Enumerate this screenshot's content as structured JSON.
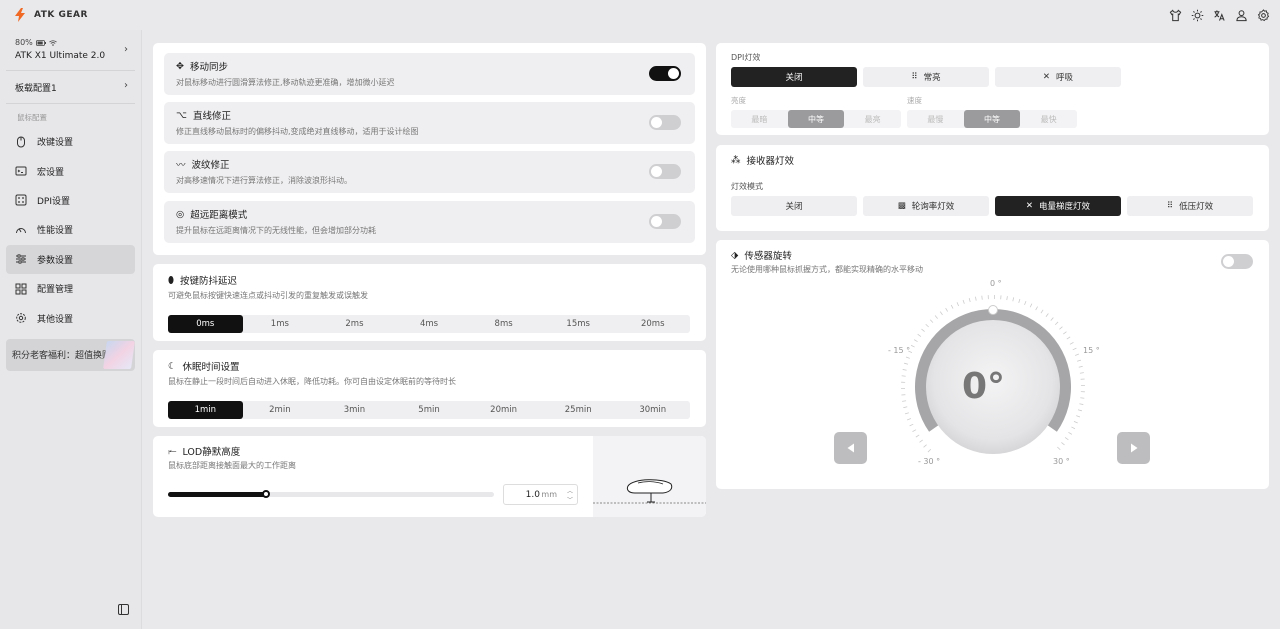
{
  "brand": {
    "name": "ATK GEAR"
  },
  "topbar": {
    "icons": [
      "shirt-icon",
      "sun-icon",
      "translate-icon",
      "user-icon",
      "gear-icon"
    ]
  },
  "device": {
    "battery": "80%",
    "name": "ATK X1 Ultimate 2.0"
  },
  "profile": {
    "label": "板载配置1"
  },
  "sidebar": {
    "section_label": "鼠标配置",
    "items": [
      {
        "label": "改键设置",
        "icon": "mouse-icon"
      },
      {
        "label": "宏设置",
        "icon": "macro-icon"
      },
      {
        "label": "DPI设置",
        "icon": "dpi-icon"
      },
      {
        "label": "性能设置",
        "icon": "gauge-icon"
      },
      {
        "label": "参数设置",
        "icon": "sliders-icon"
      },
      {
        "label": "配置管理",
        "icon": "grid-icon"
      },
      {
        "label": "其他设置",
        "icon": "gear-icon"
      }
    ],
    "active_index": 4,
    "promo": "积分老客福利：超值换购"
  },
  "features": [
    {
      "title": "移动同步",
      "desc": "对鼠标移动进行圆滑算法修正,移动轨迹更准确，增加微小延迟",
      "on": true
    },
    {
      "title": "直线修正",
      "desc": "修正直线移动鼠标时的偏移抖动,变成绝对直线移动，适用于设计绘图",
      "on": false
    },
    {
      "title": "波纹修正",
      "desc": "对高移速情况下进行算法修正，消除波浪形抖动。",
      "on": false
    },
    {
      "title": "超远距离模式",
      "desc": "提升鼠标在远距离情况下的无线性能，但会增加部分功耗",
      "on": false
    }
  ],
  "debounce": {
    "title": "按键防抖延迟",
    "desc": "可避免鼠标按键快速连点或抖动引发的重复触发或误触发",
    "options": [
      "0ms",
      "1ms",
      "2ms",
      "4ms",
      "8ms",
      "15ms",
      "20ms"
    ],
    "selected": 0
  },
  "sleep": {
    "title": "休眠时间设置",
    "desc": "鼠标在静止一段时间后自动进入休眠，降低功耗。你可自由设定休眠前的等待时长",
    "options": [
      "1min",
      "2min",
      "3min",
      "5min",
      "20min",
      "25min",
      "30min"
    ],
    "selected": 0
  },
  "lod": {
    "title": "LOD静默高度",
    "desc": "鼠标底部距离接触面最大的工作距离",
    "value": "1.0",
    "unit": "mm",
    "slider_fraction": 0.3
  },
  "dpi_light": {
    "label": "DPI灯效",
    "modes": [
      "关闭",
      "常亮",
      "呼吸"
    ],
    "selected": 0,
    "brightness_label": "亮度",
    "brightness": [
      "最暗",
      "中等",
      "最亮"
    ],
    "brightness_selected": 1,
    "speed_label": "速度",
    "speed": [
      "最慢",
      "中等",
      "最快"
    ],
    "speed_selected": 1
  },
  "receiver": {
    "title": "接收器灯效",
    "mode_label": "灯效模式",
    "modes": [
      "关闭",
      "轮询率灯效",
      "电量梯度灯效",
      "低压灯效"
    ],
    "selected": 2
  },
  "sensor": {
    "title": "传感器旋转",
    "desc": "无论使用哪种鼠标抓握方式，都能实现精确的水平移动",
    "on": false,
    "angle": "0°",
    "labels": {
      "top": "0 °",
      "left": "- 15 °",
      "right": "15 °",
      "bl": "- 30 °",
      "br": "30 °"
    }
  },
  "colors": {
    "accent": "#111111",
    "panel": "#ffffff",
    "bg": "#e9e9ec",
    "brand": "#f06a25"
  }
}
